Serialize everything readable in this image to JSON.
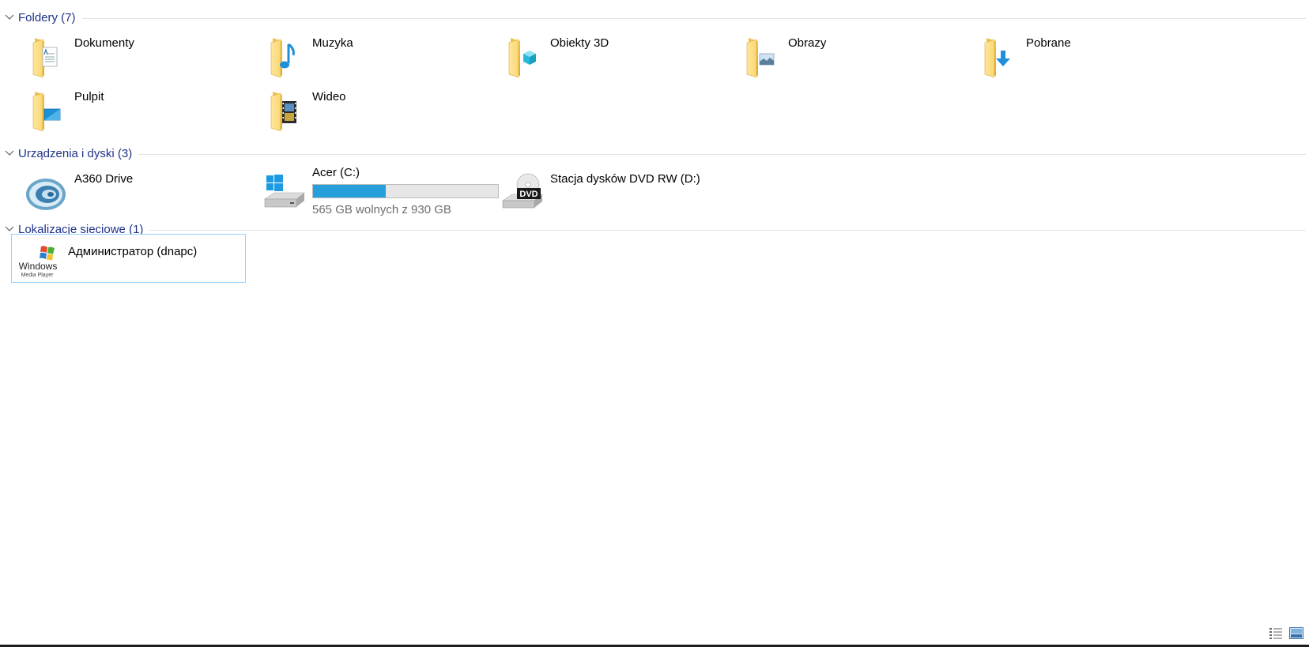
{
  "groups": {
    "folders": {
      "title": "Foldery (7)",
      "items": [
        {
          "label": "Dokumenty",
          "icon": "documents-folder-icon"
        },
        {
          "label": "Muzyka",
          "icon": "music-folder-icon"
        },
        {
          "label": "Obiekty 3D",
          "icon": "3d-objects-folder-icon"
        },
        {
          "label": "Obrazy",
          "icon": "pictures-folder-icon"
        },
        {
          "label": "Pobrane",
          "icon": "downloads-folder-icon"
        },
        {
          "label": "Pulpit",
          "icon": "desktop-folder-icon"
        },
        {
          "label": "Wideo",
          "icon": "videos-folder-icon"
        }
      ]
    },
    "devices": {
      "title": "Urządzenia i dyski (3)",
      "items": [
        {
          "label": "A360 Drive",
          "icon": "a360-drive-icon"
        },
        {
          "label": "Acer (C:)",
          "icon": "windows-drive-icon",
          "space_text": "565 GB wolnych z 930 GB",
          "used_fraction": 0.392,
          "bar_color": "#26a0da"
        },
        {
          "label": "Stacja dysków DVD RW (D:)",
          "icon": "dvd-drive-icon",
          "badge": "DVD"
        }
      ]
    },
    "network": {
      "title": "Lokalizacje sieciowe (1)",
      "items": [
        {
          "label": "Администратор (dnapc)",
          "icon": "windows-media-player-icon",
          "logo_text_1": "Windows",
          "logo_text_2": "Media Player"
        }
      ]
    }
  },
  "colors": {
    "group_title": "#1e3287",
    "selection_border": "#99d1ff",
    "progress_fill": "#26a0da",
    "folder_yellow": "#f8d775"
  },
  "view_buttons": [
    {
      "name": "details-view-button",
      "icon": "details-view-icon"
    },
    {
      "name": "large-icons-view-button",
      "icon": "large-icons-view-icon"
    }
  ]
}
